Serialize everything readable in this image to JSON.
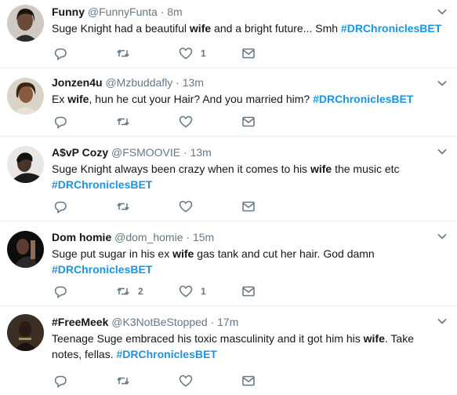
{
  "tweets": [
    {
      "name": "Funny",
      "handle": "@FunnyFunta",
      "separator": "·",
      "time": "8m",
      "text_parts": [
        "Suge Knight had a beautiful ",
        "wife",
        " and a bright future... Smh ",
        "#DRChroniclesBET"
      ],
      "reply_count": "",
      "retweet_count": "",
      "like_count": "1"
    },
    {
      "name": "Jonzen4u",
      "handle": "@Mzbuddafly",
      "separator": "·",
      "time": "13m",
      "text_parts": [
        "Ex ",
        "wife",
        ", hun he cut your Hair? And you married him? ",
        "#DRChroniclesBET"
      ],
      "reply_count": "",
      "retweet_count": "",
      "like_count": ""
    },
    {
      "name": "A$vP Cozy",
      "handle": "@FSMOOVIE",
      "separator": "·",
      "time": "13m",
      "text_parts": [
        "Suge Knight always been crazy when it comes to his ",
        "wife",
        " the music etc",
        "#DRChroniclesBET"
      ],
      "reply_count": "",
      "retweet_count": "",
      "like_count": ""
    },
    {
      "name": "Dom homie",
      "handle": "@dom_homie",
      "separator": "·",
      "time": "15m",
      "text_parts": [
        "Suge put sugar in his ex ",
        "wife",
        " gas tank and cut her hair. God damn",
        "#DRChroniclesBET"
      ],
      "reply_count": "",
      "retweet_count": "2",
      "like_count": "1"
    },
    {
      "name": "#FreeMeek",
      "handle": "@K3NotBeStopped",
      "separator": "·",
      "time": "17m",
      "text_parts": [
        "Teenage Suge embraced his toxic masculinity and it got him his ",
        "wife",
        ". Take notes, fellas. ",
        "#DRChroniclesBET"
      ],
      "reply_count": "",
      "retweet_count": "",
      "like_count": ""
    }
  ],
  "icons": {
    "reply": "reply-icon",
    "retweet": "retweet-icon",
    "like": "heart-icon",
    "message": "envelope-icon",
    "menu": "chevron-down-icon"
  },
  "colors": {
    "hashtag": "#1b95e0",
    "meta": "#657786",
    "text": "#14171a",
    "divider": "#e6ecf0"
  }
}
